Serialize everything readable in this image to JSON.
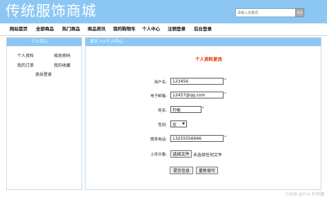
{
  "header": {
    "site_title": "传统服饰商城",
    "search_placeholder": "请输入关键词",
    "search_button": "GO"
  },
  "nav": {
    "items": [
      "网站首页",
      "全部商品",
      "热门商品",
      "商品资讯",
      "我的购物车",
      "个人中心",
      "注销登录",
      "后台登录"
    ]
  },
  "left_panel": {
    "title": "个人中心",
    "links": [
      "个人资料",
      "修改密码",
      "我的订单",
      "我的收藏",
      "退出登录"
    ]
  },
  "right_panel": {
    "breadcrumb": "首页 >>个人中心",
    "form_title": "个人资料更改",
    "fields": {
      "username": {
        "label": "用户名:",
        "value": "123456"
      },
      "email": {
        "label": "电子邮箱:",
        "value": "12457@qq.com"
      },
      "name": {
        "label": "姓名:",
        "value": "柠栀"
      },
      "gender": {
        "label": "性别:",
        "value": "女"
      },
      "phone": {
        "label": "联系电话:",
        "value": "13255556666"
      },
      "avatar": {
        "label": "上传头像:",
        "button": "选择文件",
        "status": "未选择任何文件"
      }
    },
    "submit_button": "提交信息",
    "reset_button": "重新填写"
  },
  "watermark": "CSDN @Y'm 柠序猿",
  "colors": {
    "header_bg": "#8cc7f4",
    "accent_red": "#e03000"
  }
}
